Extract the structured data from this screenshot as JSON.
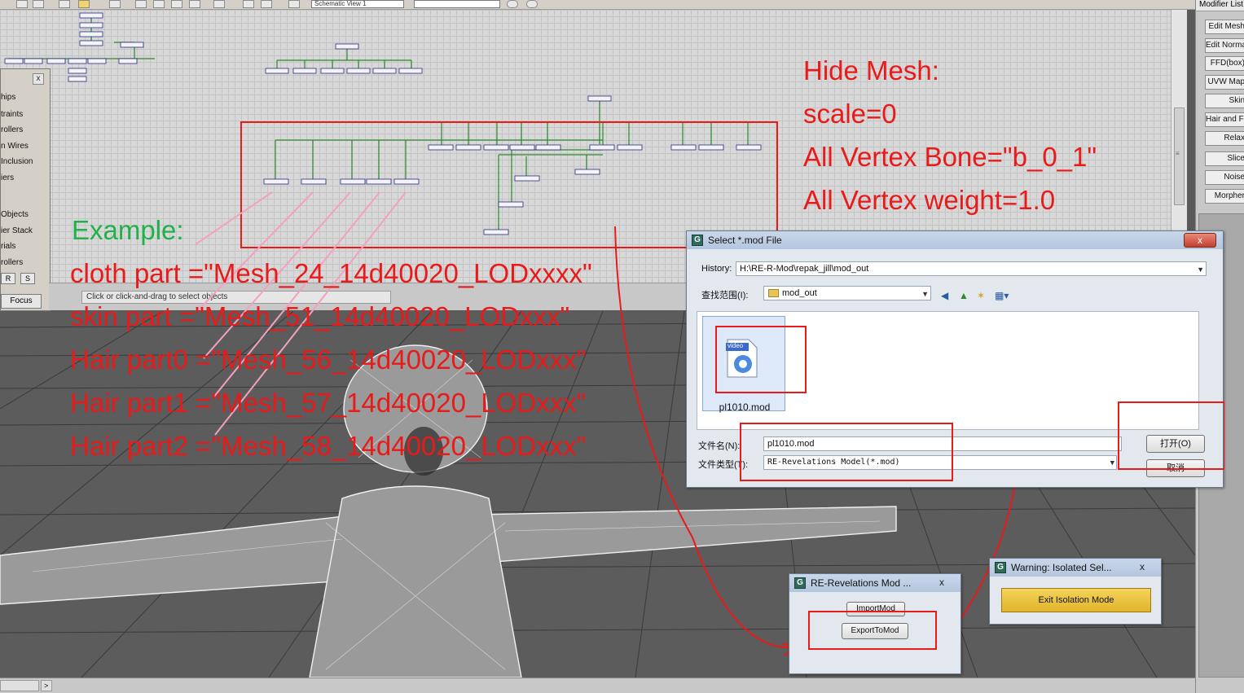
{
  "toolbar": {
    "schematic_view": "Schematic View 1"
  },
  "left_panel": {
    "items": [
      "hips",
      "traints",
      "rollers",
      "n Wires",
      "Inclusion",
      "iers",
      "Objects",
      "ier Stack",
      "rials",
      "rollers"
    ],
    "btn_r": "R",
    "btn_s": "S",
    "focus": "Focus",
    "close": "x"
  },
  "status": {
    "prompt": "Click or click-and-drag to select objects"
  },
  "command_panel": {
    "modifier_list": "Modifier List",
    "modifiers": [
      "Edit Mesh",
      "Edit Normals",
      "FFD(box)",
      "UVW Map",
      "Skin",
      "Hair and Fur",
      "Relax",
      "Slice",
      "Noise",
      "Morpher"
    ]
  },
  "annotations": {
    "hide_mesh": "Hide Mesh:",
    "scale": "scale=0",
    "vertex_bone": "All Vertex Bone=\"b_0_1\"",
    "vertex_weight": "All Vertex weight=1.0",
    "example": "Example:",
    "cloth": "cloth part =\"Mesh_24_14d40020_LODxxxx\"",
    "skin": "skin part =\"Mesh_51_14d40020_LODxxx\"",
    "hair0": "Hair part0 =\"Mesh_56_14d40020_LODxxx\"",
    "hair1": "Hair part1 =\"Mesh_57_14d40020_LODxxx\"",
    "hair2": "Hair part2 =\"Mesh_58_14d40020_LODxxx\""
  },
  "file_dialog": {
    "title": "Select *.mod File",
    "history_label": "History:",
    "history_value": "H:\\RE-R-Mod\\repak_jill\\mod_out",
    "look_in_label": "查找范围(I):",
    "look_in_value": "mod_out",
    "file_badge": "video",
    "file_name": "pl1010.mod",
    "filename_label": "文件名(N):",
    "filename_value": "pl1010.mod",
    "filetype_label": "文件类型(T):",
    "filetype_value": "RE-Revelations Model(*.mod)",
    "open": "打开(O)",
    "cancel": "取消",
    "close": "x"
  },
  "mod_dialog": {
    "title": "RE-Revelations Mod ...",
    "import": "ImportMod",
    "export": "ExportToMod",
    "close": "x"
  },
  "warning_dialog": {
    "title": "Warning: Isolated Sel...",
    "exit": "Exit Isolation Mode",
    "close": "x"
  },
  "colors": {
    "annotation_red": "#e81a1a",
    "annotation_green": "#22b04a",
    "annotation_pink": "#f4a0c0",
    "warning_button": "#e2b42a"
  }
}
